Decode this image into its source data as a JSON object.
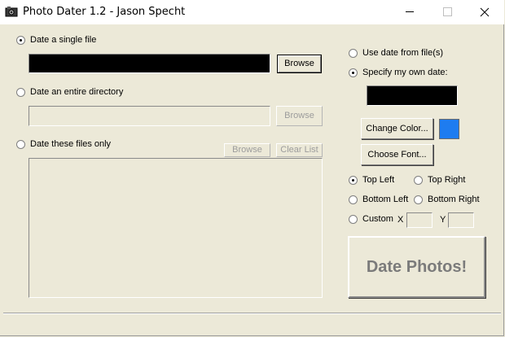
{
  "window": {
    "title": "Photo Dater 1.2 - Jason Specht",
    "icon": "camera-icon"
  },
  "source": {
    "single_file": {
      "label": "Date a single file",
      "selected": true,
      "browse_label": "Browse",
      "value": ""
    },
    "directory": {
      "label": "Date an entire directory",
      "selected": false,
      "browse_label": "Browse",
      "value": ""
    },
    "files_only": {
      "label": "Date these files only",
      "selected": false,
      "browse_label": "Browse",
      "clear_label": "Clear List",
      "files": []
    }
  },
  "date_mode": {
    "from_files_label": "Use date from file(s)",
    "own_date_label": "Specify my own date:",
    "selected": "own",
    "own_date_value": ""
  },
  "style": {
    "change_color_label": "Change Color...",
    "color": "#1e7cf0",
    "choose_font_label": "Choose Font..."
  },
  "position": {
    "top_left": "Top Left",
    "top_right": "Top Right",
    "bottom_left": "Bottom Left",
    "bottom_right": "Bottom Right",
    "custom": "Custom",
    "x_label": "X",
    "y_label": "Y",
    "x_value": "",
    "y_value": "",
    "selected": "top_left"
  },
  "action": {
    "date_photos_label": "Date Photos!"
  }
}
